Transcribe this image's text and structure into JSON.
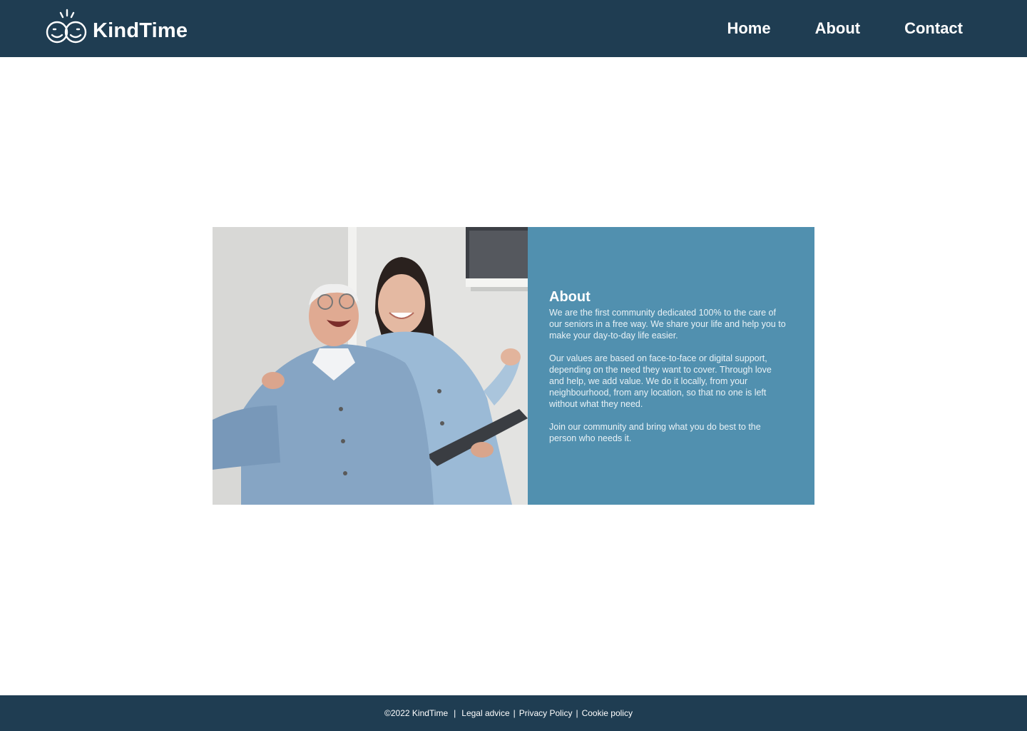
{
  "brand": {
    "name": "KindTime",
    "icon": "two-smiling-faces-logo-icon"
  },
  "nav": {
    "items": [
      {
        "label": "Home"
      },
      {
        "label": "About"
      },
      {
        "label": "Contact"
      }
    ]
  },
  "about": {
    "title": "About",
    "paragraphs": [
      "We are the first community dedicated 100% to the care of our seniors in a free way. We share your life and help you to make your day-to-day life easier.",
      "Our values are based on face-to-face or digital support, depending on the need they want to cover. Through love and help, we add value. We do it locally, from your neighbourhood, from any location, so that no one is left without what they need.",
      "Join our community and bring what you do best to the person who needs it."
    ]
  },
  "footer": {
    "copyright": "©2022 KindTime",
    "links": [
      {
        "label": "Legal advice"
      },
      {
        "label": "Privacy Policy"
      },
      {
        "label": "Cookie policy"
      }
    ],
    "separator": "|"
  },
  "colors": {
    "header_bg": "#1f3d52",
    "panel_bg": "#5190af",
    "page_bg": "#ffffff"
  }
}
